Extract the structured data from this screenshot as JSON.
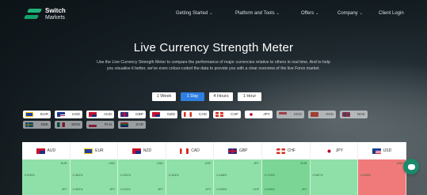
{
  "brand": {
    "name": "Switch",
    "sub": "Markets",
    "color": "#1fb57a"
  },
  "nav": [
    {
      "label": "Getting Started",
      "has_chevron": true
    },
    {
      "label": "Platform and Tools",
      "has_chevron": true
    },
    {
      "label": "Offers",
      "has_chevron": true
    },
    {
      "label": "Company",
      "has_chevron": true
    },
    {
      "label": "Client Login",
      "has_chevron": false
    }
  ],
  "hero": {
    "title": "Live Currency Strength Meter",
    "description": "Use the Live Currency Strength Meter to compare the performance of major currencies relative to others in real time. And to help you visualise it better, we've even colour-coded the data to provide you with a clear overview of the live Forex market."
  },
  "tabs": [
    {
      "label": "1 Week",
      "active": false
    },
    {
      "label": "1 Day",
      "active": true
    },
    {
      "label": "4 Hours",
      "active": false
    },
    {
      "label": "1 Hour",
      "active": false
    }
  ],
  "currency_chips_row1": [
    {
      "code": "EUR",
      "flag": "eu",
      "dim": false
    },
    {
      "code": "USD",
      "flag": "us",
      "dim": false
    },
    {
      "code": "AUD",
      "flag": "au",
      "dim": false
    },
    {
      "code": "GBP",
      "flag": "gb",
      "dim": false
    },
    {
      "code": "NZD",
      "flag": "nz",
      "dim": false
    },
    {
      "code": "CAD",
      "flag": "ca",
      "dim": false
    },
    {
      "code": "CHF",
      "flag": "ch",
      "dim": false
    },
    {
      "code": "JPY",
      "flag": "jp",
      "dim": false
    },
    {
      "code": "SGD",
      "flag": "sg",
      "dim": true
    },
    {
      "code": "HKD",
      "flag": "hk",
      "dim": true
    },
    {
      "code": "NOK",
      "flag": "no",
      "dim": true
    }
  ],
  "currency_chips_row2": [
    {
      "code": "SEK",
      "flag": "se",
      "dim": true
    },
    {
      "code": "MXN",
      "flag": "mx",
      "dim": true
    },
    {
      "code": "PLN",
      "flag": "pl",
      "dim": true
    },
    {
      "code": "ZAR",
      "flag": "za",
      "dim": true
    }
  ],
  "table": {
    "headers": [
      {
        "code": "AUD",
        "flag": "au"
      },
      {
        "code": "EUR",
        "flag": "eu"
      },
      {
        "code": "NZD",
        "flag": "nz"
      },
      {
        "code": "CAD",
        "flag": "ca"
      },
      {
        "code": "GBP",
        "flag": "gb"
      },
      {
        "code": "CHF",
        "flag": "ch"
      },
      {
        "code": "JPY",
        "flag": "jp"
      },
      {
        "code": "USD",
        "flag": "us"
      }
    ],
    "cells": [
      {
        "bg": "#8fe0a8",
        "v1": "0.005%",
        "v2": "EUR",
        "v3": "JPY",
        "v4": ""
      },
      {
        "bg": "#8fe0a8",
        "v1": "0.362%",
        "v2": "USD",
        "v3": "JPY",
        "v4": "0.302%"
      },
      {
        "bg": "#8fe0a8",
        "v1": "0.321%",
        "v2": "CAD",
        "v3": "JPY",
        "v4": "0.011%"
      },
      {
        "bg": "#8fe0a8",
        "v1": "0.344%",
        "v2": "CHF",
        "v3": "JPY",
        "v4": ""
      },
      {
        "bg": "#8fe0a8",
        "v1": "0.188%",
        "v2": "JPY",
        "v3": "CHF",
        "v4": "0.000%"
      },
      {
        "bg": "#7bd696",
        "v1": "0.178%",
        "v2": "EUR",
        "v3": "JPY",
        "v4": "0.096%"
      },
      {
        "bg": "#8fe0a8",
        "v1": "0.087%",
        "v2": "",
        "v3": "",
        "v4": ""
      },
      {
        "bg": "#f07a7a",
        "v1": "0.234%",
        "v2": "USD",
        "v3": "",
        "v4": ""
      }
    ]
  },
  "colors": {
    "active_tab": "#2f7fe0",
    "chat": "#1a8a6a"
  }
}
